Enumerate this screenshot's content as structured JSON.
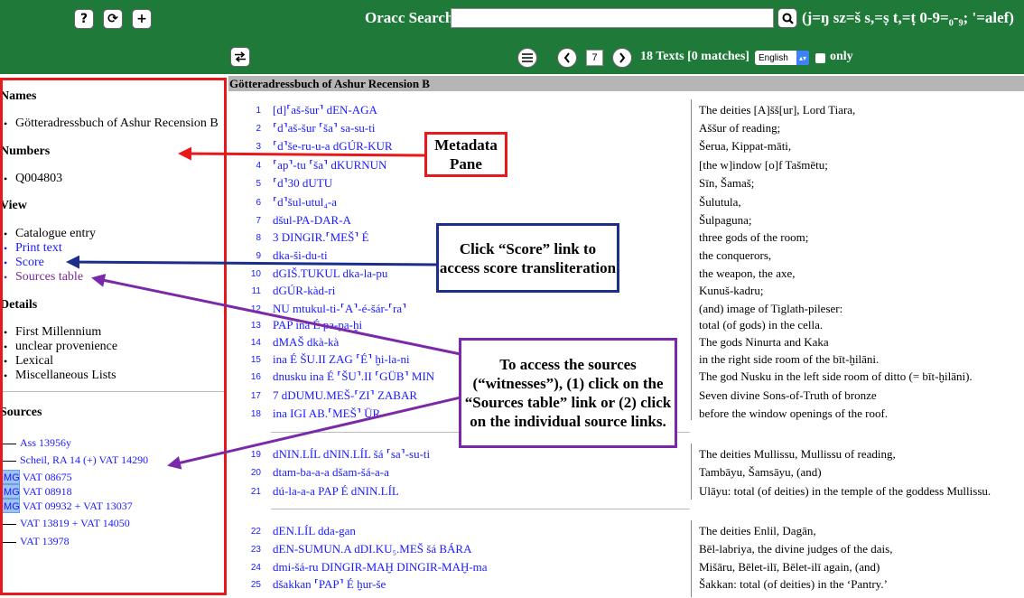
{
  "toolbar": {
    "help_label": "?",
    "reload_label": "⟳",
    "add_label": "+",
    "search_label": "Oracc Search:",
    "search_value": "",
    "search_hint": "(j=ŋ sz=š s,=ṣ t,=ṭ 0-9=₀-₉; '=alef)",
    "swap_icon": "swap-icon",
    "menu_icon": "menu-icon",
    "page_number": "7",
    "texts_count": "18 Texts [0 matches]",
    "language": "English",
    "only_label": "only",
    "colors": {
      "bar": "#1f7a3a",
      "link": "#1a1aff",
      "visited": "#7b2a91"
    }
  },
  "metadata": {
    "names_heading": "Names",
    "names": [
      "Götteradressbuch of Ashur Recension B"
    ],
    "numbers_heading": "Numbers",
    "numbers": [
      "Q004803"
    ],
    "view_heading": "View",
    "view_items": [
      "Catalogue entry",
      "Print text",
      "Score",
      "Sources table"
    ],
    "details_heading": "Details",
    "details": [
      "First Millennium",
      "unclear provenience",
      "Lexical",
      "Miscellaneous Lists"
    ],
    "sources_heading": "Sources",
    "img_label": "IMG",
    "sources": [
      {
        "label": "Ass 13956y",
        "img": false
      },
      {
        "label": "Scheil, RA 14 (+) VAT 14290",
        "img": false
      },
      {
        "label": "VAT 08675",
        "img": true
      },
      {
        "label": "VAT 08918",
        "img": true
      },
      {
        "label": "VAT 09932 + VAT 13037",
        "img": true
      },
      {
        "label": "VAT 13819 + VAT 14050",
        "img": false
      },
      {
        "label": "VAT 13978",
        "img": false
      }
    ]
  },
  "text": {
    "title": "Götteradressbuch of Ashur Recension B",
    "lines": [
      {
        "n": "1",
        "tr": "[d]⸢aš-šur⸣ dEN-AGA",
        "en": "The deities [A]šš[ur], Lord Tiara,"
      },
      {
        "n": "2",
        "tr": "⸢d⸣aš-šur ⸢ša⸣ sa-su-ti",
        "en": "Aššur of reading;"
      },
      {
        "n": "3",
        "tr": "⸢d⸣še-ru-u-a dGÚR-KUR",
        "en": "Šerua, Kippat-māti,"
      },
      {
        "n": "4",
        "tr": "⸢ap⸣-tu ⸢ša⸣ dKURNUN",
        "en": "[the w]indow [o]f Tašmētu;"
      },
      {
        "n": "5",
        "tr": "⸢d⸣30 dUTU",
        "en": "Sīn, Šamaš;"
      },
      {
        "n": "6",
        "tr": "⸢d⸣šul-utul₄-a",
        "en": "Šulutula,"
      },
      {
        "n": "7",
        "tr": "dšul-PA-DAR-A",
        "en": "Šulpaguna;"
      },
      {
        "n": "8",
        "tr": "3 DINGIR.⸢MEŠ⸣ É",
        "en": "three gods of the room;"
      },
      {
        "n": "9",
        "tr": "dka-ši-du-ti",
        "en": "the conquerors,"
      },
      {
        "n": "10",
        "tr": "dGIŠ.TUKUL dka-la-pu",
        "en": "the weapon, the axe,"
      },
      {
        "n": "11",
        "tr": "dGÚR-kàd-ri",
        "en": "Kunuš-kadru;"
      },
      {
        "n": "12",
        "tr": "NU mtukul-ti-⸢A⸣-é-šár-⸢ra⸣",
        "en": "(and) image of Tiglath-pileser:"
      },
      {
        "n": "13",
        "tr": "PAP ina É pa-pa-ḫi",
        "en": "total (of gods) in the cella."
      },
      {
        "n": "14",
        "tr": "dMAŠ dkà-kà",
        "en": "The gods Ninurta and Kaka"
      },
      {
        "n": "15",
        "tr": "ina É ŠU.II ZAG ⸢É⸣ ḫi-la-ni",
        "en": "in the right side room of the bīt-ḫilāni."
      },
      {
        "n": "16",
        "tr": "dnusku ina É ⸢ŠU⸣.II ⸢GÜB⸣ MIN",
        "en": "The god Nusku in the left side room of ditto (= bīt-ḫilāni)."
      },
      {
        "n": "17",
        "tr": "7 dDUMU.MEŠ-⸢ZI⸣ ZABAR",
        "en": "Seven divine Sons-of-Truth of bronze"
      },
      {
        "n": "18",
        "tr": "ina IGI AB.⸢MEŠ⸣ ÜR",
        "en": "before the window openings of the roof."
      },
      {
        "n": "19",
        "tr": "dNIN.LÍL dNIN.LÍL šá ⸢sa⸣-su-ti",
        "en": "The deities Mullissu, Mullissu of reading,"
      },
      {
        "n": "20",
        "tr": "dtam-ba-a-a dšam-šá-a-a",
        "en": "Tambāyu, Šamsāyu, (and)"
      },
      {
        "n": "21",
        "tr": "dú-la-a-a PAP É dNIN.LÍL",
        "en": "Ulāyu: total (of deities) in the temple of the goddess Mullissu."
      },
      {
        "n": "22",
        "tr": "dEN.LÍL dda-gan",
        "en": "The deities Enlil, Dagān,"
      },
      {
        "n": "23",
        "tr": "dEN-SUMUN.A dDI.KU₅.MEŠ šá BÁRA",
        "en": "Bēl-labriya, the divine judges of the dais,"
      },
      {
        "n": "24",
        "tr": "dmi-šá-ru DINGIR-MAḪ DINGIR-MAḪ-ma",
        "en": "Mišāru, Bēlet-ilī, Bēlet-ilī again, (and)"
      },
      {
        "n": "25",
        "tr": "dšakkan ⸢PAP⸣ É ḫur-še",
        "en": "Šakkan: total (of deities) in the ‘Pantry.’"
      }
    ]
  },
  "annotations": {
    "metadata": "Metadata Pane",
    "score": "Click “Score” link to access score transliteration",
    "sources": "To access the sources (“witnesses”), (1) click on the “Sources table” link or (2) click on the individual source links.",
    "colors": {
      "red": "#e8191a",
      "blue": "#1b2f8a",
      "purple": "#7a2aa8"
    }
  }
}
